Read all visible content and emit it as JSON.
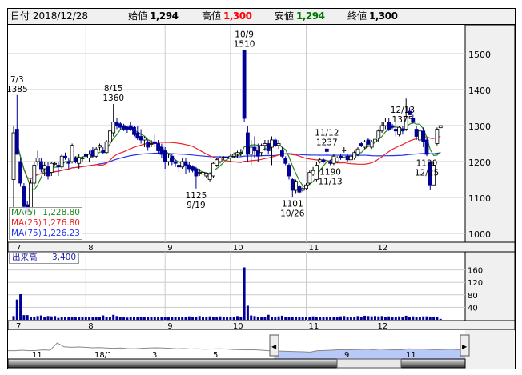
{
  "header": {
    "date_label": "日付",
    "date": "2018/12/28",
    "open_label": "始値",
    "open": "1,294",
    "high_label": "高値",
    "high": "1,300",
    "low_label": "安値",
    "low": "1,294",
    "close_label": "終値",
    "close": "1,300"
  },
  "colors": {
    "up": "#ffffff",
    "down": "#000099",
    "ma5": "#228822",
    "ma25": "#ee2222",
    "ma75": "#2233ee",
    "high_text": "#ff0000",
    "low_text": "#007700"
  },
  "legend": [
    {
      "name": "MA(5)",
      "value": "1,228.80"
    },
    {
      "name": "MA(25)",
      "value": "1,276.80"
    },
    {
      "name": "MA(75)",
      "value": "1,226.23"
    }
  ],
  "volume_legend": {
    "label": "出来高",
    "value": "3,400"
  },
  "chart_data": {
    "type": "candlestick",
    "price_ticks": [
      1000,
      1100,
      1200,
      1300,
      1400,
      1500
    ],
    "ylim": [
      980,
      1560
    ],
    "volume_ticks": [
      40,
      80,
      120,
      160
    ],
    "volume_ylim": [
      0,
      200
    ],
    "month_labels": [
      {
        "label": "7",
        "i": 0
      },
      {
        "label": "8",
        "i": 21
      },
      {
        "label": "9",
        "i": 44
      },
      {
        "label": "10",
        "i": 63
      },
      {
        "label": "11",
        "i": 85
      },
      {
        "label": "12",
        "i": 105
      }
    ],
    "annotations": [
      {
        "i": 1,
        "date": "7/3",
        "value": "1385",
        "pos": "above"
      },
      {
        "i": 29,
        "date": "8/15",
        "value": "1360",
        "pos": "above"
      },
      {
        "i": 53,
        "date": "9/19",
        "value": "1125",
        "pos": "below"
      },
      {
        "i": 67,
        "date": "10/9",
        "value": "1510",
        "pos": "above"
      },
      {
        "i": 81,
        "date": "10/26",
        "value": "1101",
        "pos": "below"
      },
      {
        "i": 91,
        "date": "11/12",
        "value": "1237",
        "pos": "above"
      },
      {
        "i": 92,
        "date": "11/13",
        "value": "1190",
        "pos": "below"
      },
      {
        "i": 113,
        "date": "12/13",
        "value": "1375",
        "pos": "above"
      },
      {
        "i": 120,
        "date": "12/25",
        "value": "1120",
        "pos": "below"
      }
    ],
    "candles": [
      [
        1150,
        1300,
        1050,
        1280,
        12
      ],
      [
        1290,
        1385,
        1220,
        1220,
        65
      ],
      [
        1200,
        1210,
        1130,
        1140,
        82
      ],
      [
        1130,
        1140,
        1060,
        1075,
        15
      ],
      [
        1080,
        1090,
        1050,
        1060,
        15
      ],
      [
        1060,
        1150,
        1050,
        1140,
        10
      ],
      [
        1140,
        1200,
        1130,
        1190,
        10
      ],
      [
        1200,
        1230,
        1190,
        1210,
        12
      ],
      [
        1200,
        1210,
        1170,
        1180,
        14
      ],
      [
        1180,
        1200,
        1160,
        1190,
        10
      ],
      [
        1185,
        1200,
        1150,
        1160,
        12
      ],
      [
        1170,
        1200,
        1160,
        1195,
        11
      ],
      [
        1195,
        1200,
        1190,
        1195,
        12
      ],
      [
        1190,
        1200,
        1160,
        1185,
        6
      ],
      [
        1185,
        1220,
        1180,
        1215,
        8
      ],
      [
        1215,
        1225,
        1205,
        1210,
        10
      ],
      [
        1200,
        1210,
        1180,
        1195,
        8
      ],
      [
        1200,
        1250,
        1195,
        1245,
        9
      ],
      [
        1210,
        1215,
        1195,
        1200,
        8
      ],
      [
        1195,
        1220,
        1180,
        1210,
        9
      ],
      [
        1210,
        1215,
        1200,
        1210,
        8
      ],
      [
        1220,
        1225,
        1210,
        1215,
        9
      ],
      [
        1210,
        1230,
        1200,
        1220,
        8
      ],
      [
        1230,
        1240,
        1210,
        1215,
        10
      ],
      [
        1215,
        1240,
        1210,
        1235,
        9
      ],
      [
        1240,
        1250,
        1230,
        1245,
        8
      ],
      [
        1230,
        1240,
        1220,
        1225,
        14
      ],
      [
        1225,
        1260,
        1220,
        1255,
        10
      ],
      [
        1255,
        1290,
        1250,
        1285,
        9
      ],
      [
        1280,
        1360,
        1270,
        1310,
        16
      ],
      [
        1310,
        1320,
        1290,
        1300,
        12
      ],
      [
        1305,
        1310,
        1290,
        1295,
        9
      ],
      [
        1300,
        1305,
        1285,
        1290,
        8
      ],
      [
        1295,
        1300,
        1280,
        1290,
        7
      ],
      [
        1300,
        1310,
        1285,
        1290,
        10
      ],
      [
        1295,
        1300,
        1270,
        1275,
        10
      ],
      [
        1280,
        1300,
        1260,
        1265,
        10
      ],
      [
        1270,
        1290,
        1250,
        1260,
        9
      ],
      [
        1260,
        1270,
        1240,
        1265,
        8
      ],
      [
        1255,
        1260,
        1230,
        1240,
        8
      ],
      [
        1250,
        1260,
        1240,
        1250,
        9
      ],
      [
        1255,
        1275,
        1240,
        1250,
        10
      ],
      [
        1250,
        1260,
        1220,
        1230,
        10
      ],
      [
        1240,
        1250,
        1210,
        1220,
        9
      ],
      [
        1230,
        1240,
        1180,
        1200,
        10
      ],
      [
        1200,
        1220,
        1190,
        1210,
        10
      ],
      [
        1215,
        1220,
        1190,
        1200,
        9
      ],
      [
        1200,
        1205,
        1185,
        1195,
        9
      ],
      [
        1190,
        1200,
        1170,
        1185,
        10
      ],
      [
        1185,
        1210,
        1180,
        1200,
        8
      ],
      [
        1200,
        1210,
        1165,
        1190,
        10
      ],
      [
        1190,
        1200,
        1170,
        1180,
        11
      ],
      [
        1185,
        1190,
        1170,
        1175,
        9
      ],
      [
        1180,
        1185,
        1125,
        1160,
        9
      ],
      [
        1170,
        1180,
        1160,
        1170,
        12
      ],
      [
        1165,
        1180,
        1160,
        1170,
        10
      ],
      [
        1160,
        1170,
        1155,
        1168,
        10
      ],
      [
        1150,
        1170,
        1145,
        1165,
        11
      ],
      [
        1160,
        1200,
        1155,
        1195,
        9
      ],
      [
        1190,
        1210,
        1185,
        1205,
        9
      ],
      [
        1200,
        1215,
        1195,
        1210,
        11
      ],
      [
        1210,
        1215,
        1205,
        1212,
        9
      ],
      [
        1212,
        1215,
        1205,
        1210,
        8
      ],
      [
        1210,
        1220,
        1200,
        1215,
        10
      ],
      [
        1215,
        1225,
        1210,
        1220,
        9
      ],
      [
        1220,
        1230,
        1210,
        1225,
        12
      ],
      [
        1225,
        1235,
        1215,
        1225,
        10
      ],
      [
        1510,
        1510,
        1310,
        1320,
        168
      ],
      [
        1280,
        1300,
        1200,
        1220,
        45
      ],
      [
        1220,
        1260,
        1190,
        1240,
        14
      ],
      [
        1240,
        1270,
        1210,
        1230,
        12
      ],
      [
        1230,
        1250,
        1200,
        1215,
        10
      ],
      [
        1225,
        1250,
        1215,
        1245,
        9
      ],
      [
        1245,
        1260,
        1230,
        1250,
        10
      ],
      [
        1250,
        1260,
        1220,
        1230,
        16
      ],
      [
        1240,
        1270,
        1190,
        1260,
        10
      ],
      [
        1260,
        1265,
        1240,
        1245,
        9
      ],
      [
        1245,
        1260,
        1235,
        1250,
        11
      ],
      [
        1230,
        1240,
        1210,
        1215,
        13
      ],
      [
        1210,
        1215,
        1190,
        1195,
        10
      ],
      [
        1190,
        1195,
        1150,
        1160,
        9
      ],
      [
        1150,
        1155,
        1101,
        1120,
        10
      ],
      [
        1120,
        1150,
        1110,
        1145,
        9
      ],
      [
        1130,
        1135,
        1110,
        1115,
        10
      ],
      [
        1120,
        1130,
        1115,
        1125,
        9
      ],
      [
        1125,
        1140,
        1120,
        1135,
        9
      ],
      [
        1140,
        1175,
        1135,
        1170,
        10
      ],
      [
        1165,
        1185,
        1160,
        1175,
        11
      ],
      [
        1150,
        1200,
        1145,
        1190,
        8
      ],
      [
        1200,
        1210,
        1195,
        1205,
        9
      ],
      [
        1205,
        1210,
        1195,
        1200,
        10
      ],
      [
        1235,
        1237,
        1225,
        1228,
        9
      ],
      [
        1200,
        1205,
        1190,
        1195,
        10
      ],
      [
        1195,
        1220,
        1190,
        1215,
        9
      ],
      [
        1200,
        1215,
        1195,
        1210,
        10
      ],
      [
        1215,
        1220,
        1205,
        1210,
        11
      ],
      [
        1230,
        1240,
        1225,
        1232,
        12
      ],
      [
        1215,
        1220,
        1200,
        1205,
        10
      ],
      [
        1205,
        1220,
        1195,
        1215,
        9
      ],
      [
        1210,
        1230,
        1205,
        1225,
        10
      ],
      [
        1220,
        1240,
        1215,
        1235,
        12
      ],
      [
        1250,
        1255,
        1240,
        1245,
        10
      ],
      [
        1240,
        1260,
        1235,
        1255,
        13
      ],
      [
        1260,
        1265,
        1245,
        1248,
        12
      ],
      [
        1240,
        1260,
        1235,
        1255,
        11
      ],
      [
        1255,
        1270,
        1240,
        1262,
        12
      ],
      [
        1265,
        1290,
        1255,
        1285,
        11
      ],
      [
        1285,
        1310,
        1280,
        1300,
        12
      ],
      [
        1300,
        1320,
        1290,
        1310,
        10
      ],
      [
        1310,
        1320,
        1285,
        1290,
        11
      ],
      [
        1300,
        1305,
        1290,
        1295,
        9
      ],
      [
        1290,
        1310,
        1270,
        1285,
        10
      ],
      [
        1275,
        1300,
        1270,
        1295,
        11
      ],
      [
        1290,
        1300,
        1275,
        1285,
        10
      ],
      [
        1290,
        1375,
        1285,
        1325,
        13
      ],
      [
        1340,
        1350,
        1330,
        1330,
        10
      ],
      [
        1320,
        1330,
        1305,
        1310,
        11
      ],
      [
        1290,
        1300,
        1260,
        1270,
        10
      ],
      [
        1260,
        1290,
        1250,
        1285,
        9
      ],
      [
        1285,
        1295,
        1240,
        1255,
        11
      ],
      [
        1260,
        1265,
        1215,
        1220,
        11
      ],
      [
        1200,
        1200,
        1120,
        1135,
        10
      ],
      [
        1135,
        1200,
        1135,
        1190,
        9
      ],
      [
        1250,
        1295,
        1245,
        1290,
        10
      ],
      [
        1294,
        1300,
        1294,
        1300,
        3
      ]
    ],
    "navigator": {
      "labels": [
        "11",
        "18/1",
        "3",
        "5",
        "9",
        "11"
      ],
      "series": [
        1100,
        1100,
        1105,
        1100,
        1102,
        1108,
        1105,
        1180,
        1140,
        1135,
        1138,
        1135,
        1130,
        1132,
        1128,
        1125,
        1128,
        1122,
        1120,
        1125,
        1128,
        1130,
        1128,
        1125,
        1120,
        1122,
        1118,
        1120,
        1115,
        1118,
        1120,
        1118,
        1112,
        1110,
        1108,
        1110,
        1105,
        1100,
        1098,
        1095,
        1092,
        1090,
        1088,
        1085,
        1100,
        1102,
        1105,
        1110,
        1108,
        1110,
        1112,
        1115,
        1110,
        1118,
        1112,
        1108,
        1110,
        1120,
        1115,
        1118,
        1112,
        1110,
        1112,
        1115,
        1110,
        1120
      ]
    }
  }
}
